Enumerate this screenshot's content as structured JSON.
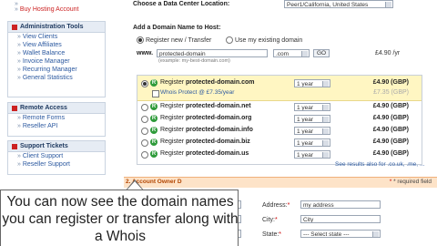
{
  "sidebar": {
    "top_items": [
      "Buy Hosting Account"
    ],
    "sections": [
      {
        "title": "Administration Tools",
        "items": [
          "View Clients",
          "View Affiliates",
          "Wallet Balance",
          "Invoice Manager",
          "Recurring Manager",
          "General Statistics"
        ]
      },
      {
        "title": "Remote Access",
        "items": [
          "Remote Forms",
          "Reseller API"
        ]
      },
      {
        "title": "Support Tickets",
        "items": [
          "Client Support",
          "Reseller Support"
        ]
      }
    ]
  },
  "main": {
    "datacenter_label": "Choose a Data Center Location:",
    "datacenter_value": "Peer1/California, United States",
    "domain_heading": "Add a Domain Name to Host:",
    "register_option": "Register new / Transfer",
    "existing_option": "Use my existing domain",
    "www_label": "www.",
    "domain_input": "protected-domain",
    "example": "(example: my-best-domain.com)",
    "tld_value": ".com",
    "go_label": "GO",
    "price_per_year": "£4.90 /yr",
    "register_word": "Register",
    "rows": [
      {
        "domain": "protected-domain.com",
        "term": "1 year",
        "price": "£4.90 (GBP)"
      },
      {
        "domain": "protected-domain.net",
        "term": "1 year",
        "price": "£4.90 (GBP)"
      },
      {
        "domain": "protected-domain.org",
        "term": "1 year",
        "price": "£4.90 (GBP)"
      },
      {
        "domain": "protected-domain.info",
        "term": "1 year",
        "price": "£4.90 (GBP)"
      },
      {
        "domain": "protected-domain.biz",
        "term": "1 year",
        "price": "£4.90 (GBP)"
      },
      {
        "domain": "protected-domain.us",
        "term": "1 year",
        "price": "£4.90 (GBP)"
      }
    ],
    "whois": {
      "label": "Whois Protect @ £7.35/year",
      "term": "1 year",
      "price": "£7.35 (GBP)"
    },
    "see_results": "See results also for .co.uk, .me, ...",
    "step2_title": "2. Account Owner D",
    "required_note": "* required field",
    "address_label": "Address:",
    "address_value": "my address",
    "city_label": "City:",
    "city_value": "City",
    "state_label": "State:",
    "state_value": "--- Select state ---",
    "required_star": "*"
  },
  "callout": {
    "text": "You can now see the domain names you can register or transfer along with a Whois"
  }
}
